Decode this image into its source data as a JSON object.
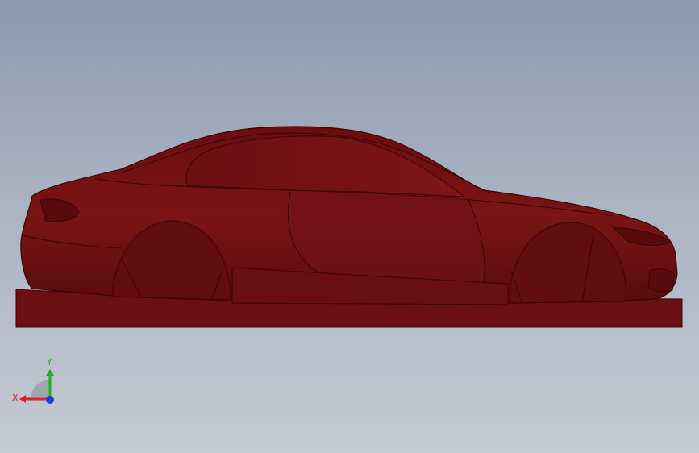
{
  "viewport": {
    "model_color": "#6b0f12",
    "background_top": "#8a9ab0",
    "background_bottom": "#c4cad3"
  },
  "triad": {
    "x_label": "X",
    "y_label": "Y",
    "x_color": "#e0202a",
    "y_color": "#22b022",
    "z_color": "#1f3fd8"
  }
}
